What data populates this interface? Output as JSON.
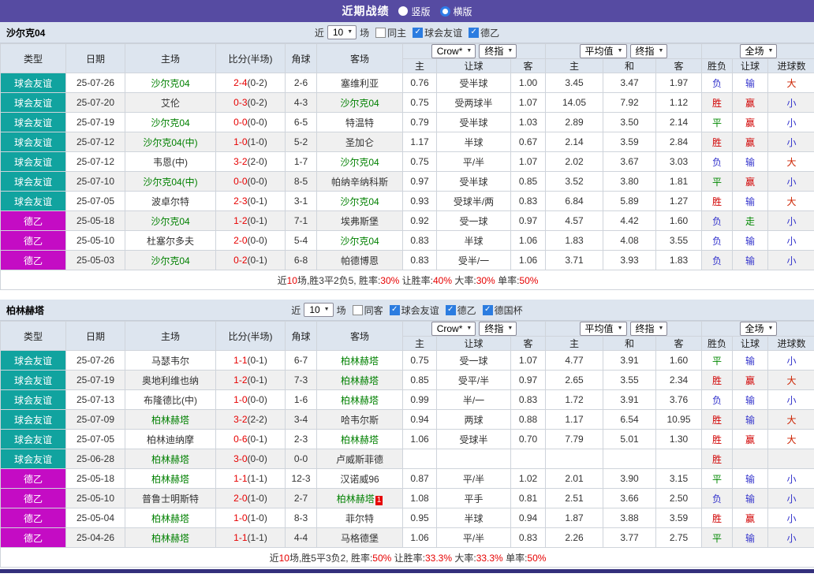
{
  "title_bar": {
    "title": "近期战绩",
    "radios": [
      {
        "label": "竖版",
        "selected": false
      },
      {
        "label": "横版",
        "selected": true
      }
    ]
  },
  "icons": {
    "chevron_down": "▼",
    "check": "✓"
  },
  "type_colors": {
    "球会友谊": "#11a39f",
    "德乙": "#c40cc4"
  },
  "result_colors": {
    "胜": "#d10000",
    "平": "#008800",
    "负": "#3333cc",
    "赢": "#d10000",
    "走": "#008800",
    "输": "#3333cc",
    "大": "#cc2200",
    "小": "#3333cc"
  },
  "theme": {
    "titlebar": "#564ba2",
    "band_bg": "#dde5ef",
    "odds_bg": "#fcf5e9",
    "avg_bg": "#eaf3fb",
    "team_green": "#008000",
    "score_red": "#e60000",
    "row_alt": "#f0f0f0",
    "bottom_bar": "#34307c",
    "checkbox_blue": "#2b7ce0"
  },
  "tables": [
    {
      "team": "沙尔克04",
      "controls": {
        "prefix": "近",
        "count": "10",
        "suffix": "场",
        "checkboxes": [
          {
            "label": "同主",
            "checked": false
          },
          {
            "label": "球会友谊",
            "checked": true
          },
          {
            "label": "德乙",
            "checked": true
          }
        ]
      },
      "header": {
        "left_cols": [
          "类型",
          "日期",
          "主场",
          "比分(半场)",
          "角球",
          "客场"
        ],
        "selects": [
          "Crow*",
          "终指",
          "平均值",
          "终指",
          "全场"
        ],
        "odds_cols": [
          "主",
          "让球",
          "客",
          "主",
          "和",
          "客",
          "胜负",
          "让球",
          "进球数"
        ]
      },
      "rows": [
        {
          "type": "球会友谊",
          "date": "25-07-26",
          "home": "沙尔克04",
          "score": "2-4",
          "half": "(0-2)",
          "corner": "2-6",
          "away": "塞维利亚",
          "odds": [
            "0.76",
            "受半球",
            "1.00"
          ],
          "avg": [
            "3.45",
            "3.47",
            "1.97"
          ],
          "results": [
            "负",
            "输",
            "大"
          ]
        },
        {
          "type": "球会友谊",
          "date": "25-07-20",
          "home": "艾伦",
          "score": "0-3",
          "half": "(0-2)",
          "corner": "4-3",
          "away": "沙尔克04",
          "odds": [
            "0.75",
            "受两球半",
            "1.07"
          ],
          "avg": [
            "14.05",
            "7.92",
            "1.12"
          ],
          "results": [
            "胜",
            "赢",
            "小"
          ]
        },
        {
          "type": "球会友谊",
          "date": "25-07-19",
          "home": "沙尔克04",
          "score": "0-0",
          "half": "(0-0)",
          "corner": "6-5",
          "away": "特温特",
          "odds": [
            "0.79",
            "受半球",
            "1.03"
          ],
          "avg": [
            "2.89",
            "3.50",
            "2.14"
          ],
          "results": [
            "平",
            "赢",
            "小"
          ]
        },
        {
          "type": "球会友谊",
          "date": "25-07-12",
          "home": "沙尔克04(中)",
          "score": "1-0",
          "half": "(1-0)",
          "corner": "5-2",
          "away": "圣加仑",
          "odds": [
            "1.17",
            "半球",
            "0.67"
          ],
          "avg": [
            "2.14",
            "3.59",
            "2.84"
          ],
          "results": [
            "胜",
            "赢",
            "小"
          ]
        },
        {
          "type": "球会友谊",
          "date": "25-07-12",
          "home": "韦恩(中)",
          "score": "3-2",
          "half": "(2-0)",
          "corner": "1-7",
          "away": "沙尔克04",
          "odds": [
            "0.75",
            "平/半",
            "1.07"
          ],
          "avg": [
            "2.02",
            "3.67",
            "3.03"
          ],
          "results": [
            "负",
            "输",
            "大"
          ]
        },
        {
          "type": "球会友谊",
          "date": "25-07-10",
          "home": "沙尔克04(中)",
          "score": "0-0",
          "half": "(0-0)",
          "corner": "8-5",
          "away": "帕纳辛纳科斯",
          "odds": [
            "0.97",
            "受半球",
            "0.85"
          ],
          "avg": [
            "3.52",
            "3.80",
            "1.81"
          ],
          "results": [
            "平",
            "赢",
            "小"
          ]
        },
        {
          "type": "球会友谊",
          "date": "25-07-05",
          "home": "波卓尔特",
          "score": "2-3",
          "half": "(0-1)",
          "corner": "3-1",
          "away": "沙尔克04",
          "odds": [
            "0.93",
            "受球半/两",
            "0.83"
          ],
          "avg": [
            "6.84",
            "5.89",
            "1.27"
          ],
          "results": [
            "胜",
            "输",
            "大"
          ]
        },
        {
          "type": "德乙",
          "date": "25-05-18",
          "home": "沙尔克04",
          "score": "1-2",
          "half": "(0-1)",
          "corner": "7-1",
          "away": "埃弗斯堡",
          "odds": [
            "0.92",
            "受一球",
            "0.97"
          ],
          "avg": [
            "4.57",
            "4.42",
            "1.60"
          ],
          "results": [
            "负",
            "走",
            "小"
          ]
        },
        {
          "type": "德乙",
          "date": "25-05-10",
          "home": "杜塞尔多夫",
          "score": "2-0",
          "half": "(0-0)",
          "corner": "5-4",
          "away": "沙尔克04",
          "odds": [
            "0.83",
            "半球",
            "1.06"
          ],
          "avg": [
            "1.83",
            "4.08",
            "3.55"
          ],
          "results": [
            "负",
            "输",
            "小"
          ]
        },
        {
          "type": "德乙",
          "date": "25-05-03",
          "home": "沙尔克04",
          "score": "0-2",
          "half": "(0-1)",
          "corner": "6-8",
          "away": "帕德博恩",
          "odds": [
            "0.83",
            "受半/一",
            "1.06"
          ],
          "avg": [
            "3.71",
            "3.93",
            "1.83"
          ],
          "results": [
            "负",
            "输",
            "小"
          ]
        }
      ],
      "summary": [
        {
          "text": "近",
          "red": false
        },
        {
          "text": "10",
          "red": true
        },
        {
          "text": "场,胜3平2负5, 胜率:",
          "red": false
        },
        {
          "text": "30%",
          "red": true
        },
        {
          "text": " 让胜率:",
          "red": false
        },
        {
          "text": "40%",
          "red": true
        },
        {
          "text": " 大率:",
          "red": false
        },
        {
          "text": "30%",
          "red": true
        },
        {
          "text": " 单率:",
          "red": false
        },
        {
          "text": "50%",
          "red": true
        }
      ]
    },
    {
      "team": "柏林赫塔",
      "controls": {
        "prefix": "近",
        "count": "10",
        "suffix": "场",
        "checkboxes": [
          {
            "label": "同客",
            "checked": false
          },
          {
            "label": "球会友谊",
            "checked": true
          },
          {
            "label": "德乙",
            "checked": true
          },
          {
            "label": "德国杯",
            "checked": true
          }
        ]
      },
      "header": {
        "left_cols": [
          "类型",
          "日期",
          "主场",
          "比分(半场)",
          "角球",
          "客场"
        ],
        "selects": [
          "Crow*",
          "终指",
          "平均值",
          "终指",
          "全场"
        ],
        "odds_cols": [
          "主",
          "让球",
          "客",
          "主",
          "和",
          "客",
          "胜负",
          "让球",
          "进球数"
        ]
      },
      "rows": [
        {
          "type": "球会友谊",
          "date": "25-07-26",
          "home": "马瑟韦尔",
          "score": "1-1",
          "half": "(0-1)",
          "corner": "6-7",
          "away": "柏林赫塔",
          "odds": [
            "0.75",
            "受一球",
            "1.07"
          ],
          "avg": [
            "4.77",
            "3.91",
            "1.60"
          ],
          "results": [
            "平",
            "输",
            "小"
          ]
        },
        {
          "type": "球会友谊",
          "date": "25-07-19",
          "home": "奥地利维也纳",
          "score": "1-2",
          "half": "(0-1)",
          "corner": "7-3",
          "away": "柏林赫塔",
          "odds": [
            "0.85",
            "受平/半",
            "0.97"
          ],
          "avg": [
            "2.65",
            "3.55",
            "2.34"
          ],
          "results": [
            "胜",
            "赢",
            "大"
          ]
        },
        {
          "type": "球会友谊",
          "date": "25-07-13",
          "home": "布隆德比(中)",
          "score": "1-0",
          "half": "(0-0)",
          "corner": "1-6",
          "away": "柏林赫塔",
          "odds": [
            "0.99",
            "半/一",
            "0.83"
          ],
          "avg": [
            "1.72",
            "3.91",
            "3.76"
          ],
          "results": [
            "负",
            "输",
            "小"
          ]
        },
        {
          "type": "球会友谊",
          "date": "25-07-09",
          "home": "柏林赫塔",
          "score": "3-2",
          "half": "(2-2)",
          "corner": "3-4",
          "away": "哈韦尔斯",
          "odds": [
            "0.94",
            "两球",
            "0.88"
          ],
          "avg": [
            "1.17",
            "6.54",
            "10.95"
          ],
          "results": [
            "胜",
            "输",
            "大"
          ]
        },
        {
          "type": "球会友谊",
          "date": "25-07-05",
          "home": "柏林迪纳摩",
          "score": "0-6",
          "half": "(0-1)",
          "corner": "2-3",
          "away": "柏林赫塔",
          "odds": [
            "1.06",
            "受球半",
            "0.70"
          ],
          "avg": [
            "7.79",
            "5.01",
            "1.30"
          ],
          "results": [
            "胜",
            "赢",
            "大"
          ]
        },
        {
          "type": "球会友谊",
          "date": "25-06-28",
          "home": "柏林赫塔",
          "score": "3-0",
          "half": "(0-0)",
          "corner": "0-0",
          "away": "卢威斯菲德",
          "odds": [
            "",
            "",
            ""
          ],
          "avg": [
            "",
            "",
            ""
          ],
          "results": [
            "胜",
            "",
            ""
          ]
        },
        {
          "type": "德乙",
          "date": "25-05-18",
          "home": "柏林赫塔",
          "score": "1-1",
          "half": "(1-1)",
          "corner": "12-3",
          "away": "汉诺威96",
          "odds": [
            "0.87",
            "平/半",
            "1.02"
          ],
          "avg": [
            "2.01",
            "3.90",
            "3.15"
          ],
          "results": [
            "平",
            "输",
            "小"
          ]
        },
        {
          "type": "德乙",
          "date": "25-05-10",
          "home": "普鲁士明斯特",
          "score": "2-0",
          "half": "(1-0)",
          "corner": "2-7",
          "away": "柏林赫塔",
          "badge": "1",
          "odds": [
            "1.08",
            "平手",
            "0.81"
          ],
          "avg": [
            "2.51",
            "3.66",
            "2.50"
          ],
          "results": [
            "负",
            "输",
            "小"
          ]
        },
        {
          "type": "德乙",
          "date": "25-05-04",
          "home": "柏林赫塔",
          "score": "1-0",
          "half": "(1-0)",
          "corner": "8-3",
          "away": "菲尔特",
          "odds": [
            "0.95",
            "半球",
            "0.94"
          ],
          "avg": [
            "1.87",
            "3.88",
            "3.59"
          ],
          "results": [
            "胜",
            "赢",
            "小"
          ]
        },
        {
          "type": "德乙",
          "date": "25-04-26",
          "home": "柏林赫塔",
          "score": "1-1",
          "half": "(1-1)",
          "corner": "4-4",
          "away": "马格德堡",
          "odds": [
            "1.06",
            "平/半",
            "0.83"
          ],
          "avg": [
            "2.26",
            "3.77",
            "2.75"
          ],
          "results": [
            "平",
            "输",
            "小"
          ]
        }
      ],
      "summary": [
        {
          "text": "近",
          "red": false
        },
        {
          "text": "10",
          "red": true
        },
        {
          "text": "场,胜5平3负2, 胜率:",
          "red": false
        },
        {
          "text": "50%",
          "red": true
        },
        {
          "text": " 让胜率:",
          "red": false
        },
        {
          "text": "33.3%",
          "red": true
        },
        {
          "text": " 大率:",
          "red": false
        },
        {
          "text": "33.3%",
          "red": true
        },
        {
          "text": " 单率:",
          "red": false
        },
        {
          "text": "50%",
          "red": true
        }
      ]
    }
  ]
}
